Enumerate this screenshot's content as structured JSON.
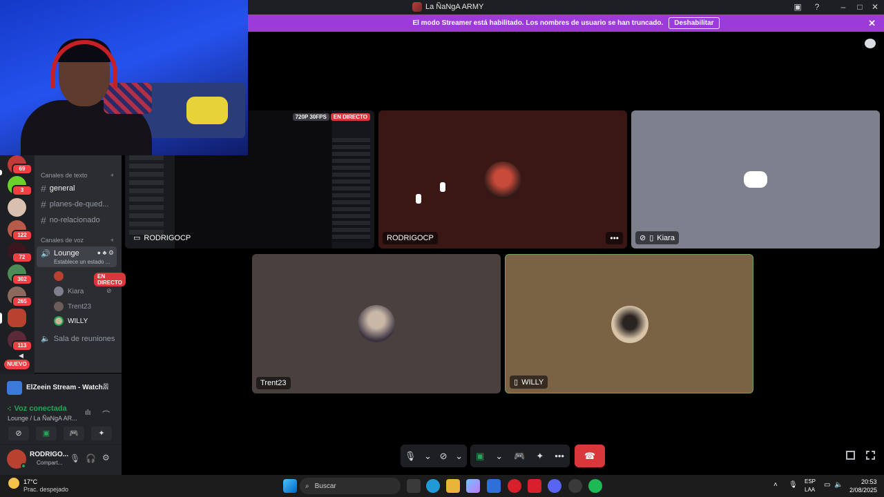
{
  "window": {
    "title": "La ÑaNgA ARMY"
  },
  "banner": {
    "text": "El modo Streamer está habilitado. Los nombres de usuario se han truncado.",
    "button": "Deshabilitar"
  },
  "servers": {
    "badges": [
      "69",
      "3",
      "122",
      "72",
      "302",
      "265",
      "113"
    ],
    "new_label": "NUEVO"
  },
  "channels": {
    "text_category": "Canales de texto",
    "text_channels": [
      "general",
      "planes-de-qued...",
      "no-relacionado"
    ],
    "voice_category": "Canales de voz",
    "lounge": {
      "name": "Lounge",
      "status": "Establece un estado ..."
    },
    "live_badge": "EN DIRECTO",
    "voice_users": [
      "Kiara",
      "Trent23",
      "WILLY"
    ],
    "other_voice": "Sala de reuniones"
  },
  "activity": {
    "text": "ElZeein Stream - Watch..."
  },
  "voice": {
    "status": "Voz conectada",
    "location": "Lounge / La ÑaNgA AR..."
  },
  "user": {
    "name": "RODRIGO...",
    "status": "Compart..."
  },
  "stage": {
    "stream_quality": "720P 30FPS",
    "stream_live": "EN DIRECTO",
    "tiles": [
      {
        "name": "RODRIGOCP"
      },
      {
        "name": "RODRIGOCP"
      },
      {
        "name": "Kiara"
      },
      {
        "name": "Trent23"
      },
      {
        "name": "WILLY"
      }
    ]
  },
  "taskbar": {
    "weather_temp": "17°C",
    "weather_desc": "Prac. despejado",
    "search_placeholder": "Buscar",
    "lang": "ESP",
    "lang2": "LAA",
    "time": "20:53",
    "date": "2/08/2025"
  },
  "colors": {
    "banner": "#9c3bd8",
    "hangup": "#da373c",
    "tile_rodrigo": "#3a1714",
    "tile_kiara": "#7e818d",
    "tile_trent": "#4a403e",
    "tile_willy": "#7a6245"
  }
}
